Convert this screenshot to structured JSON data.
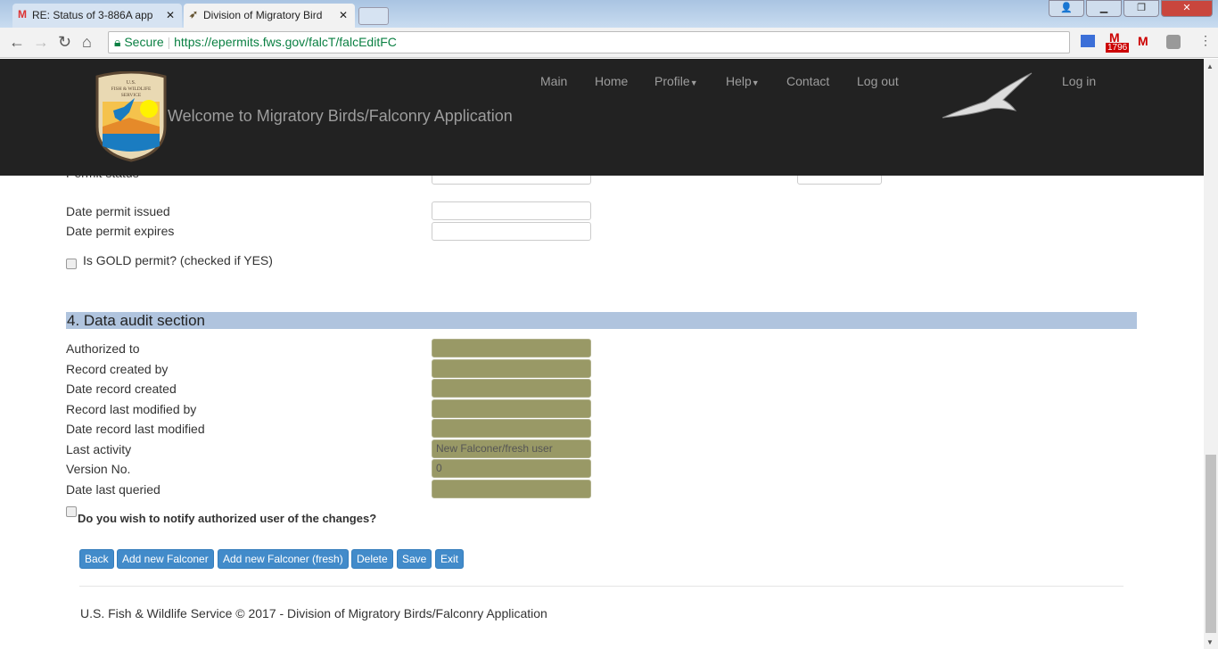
{
  "browser": {
    "tabs": [
      {
        "title": "RE: Status of 3-886A app",
        "icon": "gmail-icon"
      },
      {
        "title": "Division of Migratory Bird",
        "icon": "bird-icon"
      }
    ],
    "secure_label": "Secure",
    "url": "https://epermits.fws.gov/falcT/falcEditFC",
    "ext_badge": "1796"
  },
  "header": {
    "logo_text": "U.S. FISH & WILDLIFE SERVICE",
    "welcome": "Welcome to Migratory Birds/Falconry Application",
    "nav": [
      "Main",
      "Home",
      "Profile",
      "Help",
      "Contact",
      "Log out"
    ],
    "login": "Log in"
  },
  "permit": {
    "status_label": "Permit status",
    "fields": [
      {
        "label": "Date permit issued",
        "value": ""
      },
      {
        "label": "Date permit expires",
        "value": ""
      }
    ],
    "gold_label": "Is GOLD permit? (checked if YES)"
  },
  "audit": {
    "title": "4. Data audit section",
    "fields": [
      {
        "label": "Authorized to",
        "value": ""
      },
      {
        "label": "Record created by",
        "value": ""
      },
      {
        "label": "Date record created",
        "value": ""
      },
      {
        "label": "Record last modified by",
        "value": ""
      },
      {
        "label": "Date record last modified",
        "value": ""
      },
      {
        "label": "Last activity",
        "value": "New Falconer/fresh user"
      },
      {
        "label": "Version No.",
        "value": "0"
      },
      {
        "label": "Date last queried",
        "value": ""
      }
    ],
    "notify_label": "Do you wish to notify authorized user of the changes?"
  },
  "buttons": [
    "Back",
    "Add new Falconer",
    "Add new Falconer (fresh)",
    "Delete",
    "Save",
    "Exit"
  ],
  "footer": "U.S. Fish & Wildlife Service © 2017 - Division of Migratory Birds/Falconry Application"
}
